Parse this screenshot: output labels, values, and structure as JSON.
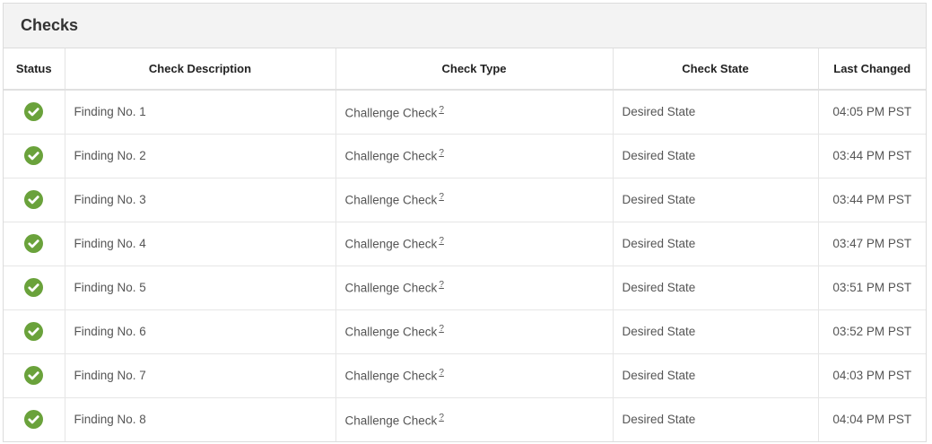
{
  "panel": {
    "title": "Checks"
  },
  "columns": {
    "status": "Status",
    "description": "Check Description",
    "type": "Check Type",
    "state": "Check State",
    "last_changed": "Last Changed"
  },
  "status_icon": "check-circle-icon",
  "status_color": "#6aa23b",
  "rows": [
    {
      "description": "Finding No. 1",
      "type": "Challenge Check",
      "help": "?",
      "state": "Desired State",
      "last_changed": "04:05 PM PST"
    },
    {
      "description": "Finding No. 2",
      "type": "Challenge Check",
      "help": "?",
      "state": "Desired State",
      "last_changed": "03:44 PM PST"
    },
    {
      "description": "Finding No. 3",
      "type": "Challenge Check",
      "help": "?",
      "state": "Desired State",
      "last_changed": "03:44 PM PST"
    },
    {
      "description": "Finding No. 4",
      "type": "Challenge Check",
      "help": "?",
      "state": "Desired State",
      "last_changed": "03:47 PM PST"
    },
    {
      "description": "Finding No. 5",
      "type": "Challenge Check",
      "help": "?",
      "state": "Desired State",
      "last_changed": "03:51 PM PST"
    },
    {
      "description": "Finding No. 6",
      "type": "Challenge Check",
      "help": "?",
      "state": "Desired State",
      "last_changed": "03:52 PM PST"
    },
    {
      "description": "Finding No. 7",
      "type": "Challenge Check",
      "help": "?",
      "state": "Desired State",
      "last_changed": "04:03 PM PST"
    },
    {
      "description": "Finding No. 8",
      "type": "Challenge Check",
      "help": "?",
      "state": "Desired State",
      "last_changed": "04:04 PM PST"
    }
  ]
}
